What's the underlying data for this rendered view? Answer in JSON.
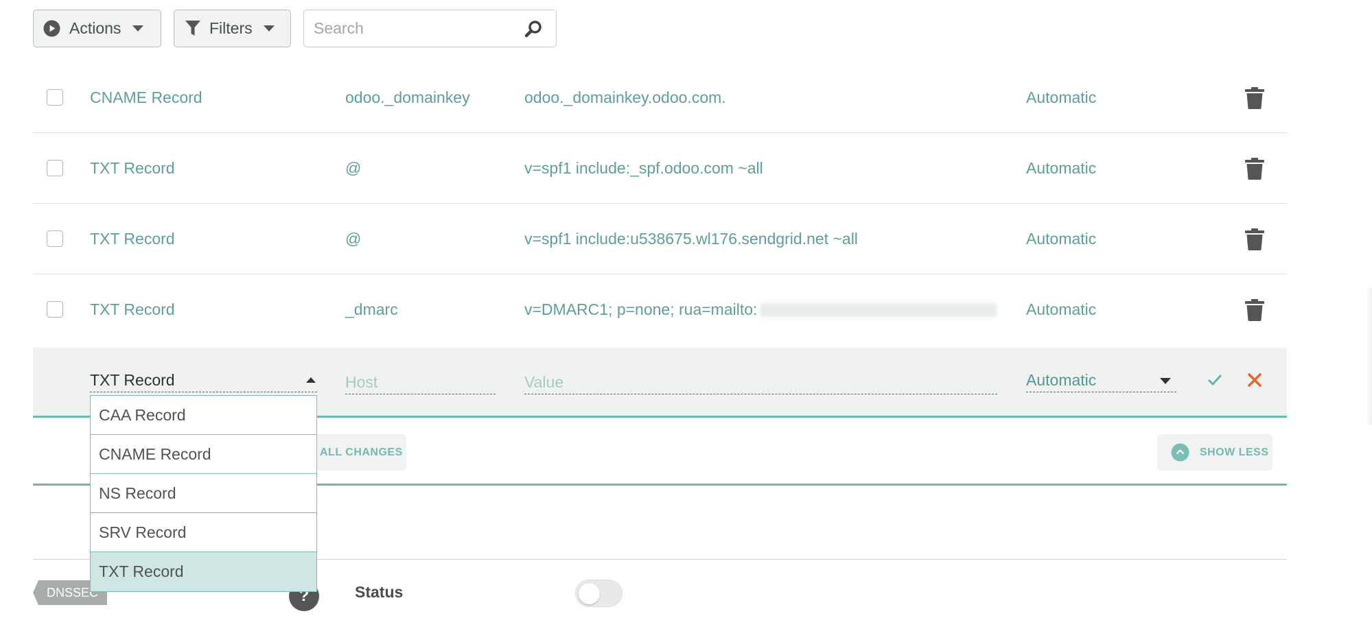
{
  "toolbar": {
    "actions_label": "Actions",
    "filters_label": "Filters",
    "search_placeholder": "Search"
  },
  "records": [
    {
      "type": "CNAME Record",
      "host": "odoo._domainkey",
      "value": "odoo._domainkey.odoo.com.",
      "ttl": "Automatic"
    },
    {
      "type": "TXT Record",
      "host": "@",
      "value": "v=spf1 include:_spf.odoo.com ~all",
      "ttl": "Automatic"
    },
    {
      "type": "TXT Record",
      "host": "@",
      "value": "v=spf1 include:u538675.wl176.sendgrid.net ~all",
      "ttl": "Automatic"
    },
    {
      "type": "TXT Record",
      "host": "_dmarc",
      "value": "v=DMARC1; p=none; rua=mailto:",
      "ttl": "Automatic"
    }
  ],
  "new_record": {
    "type_value": "TXT Record",
    "host_placeholder": "Host",
    "value_placeholder": "Value",
    "ttl_value": "Automatic"
  },
  "type_options": [
    "CAA Record",
    "CNAME Record",
    "NS Record",
    "SRV Record",
    "TXT Record"
  ],
  "action_bar": {
    "save_all_label": "ALL CHANGES",
    "show_less_label": "SHOW LESS"
  },
  "dnssec": {
    "tag_label": "DNSSEC",
    "status_label": "Status"
  },
  "colors": {
    "accent": "#5f9e9a",
    "delete": "#e8642c",
    "selected_option": "#cfe6e4"
  }
}
